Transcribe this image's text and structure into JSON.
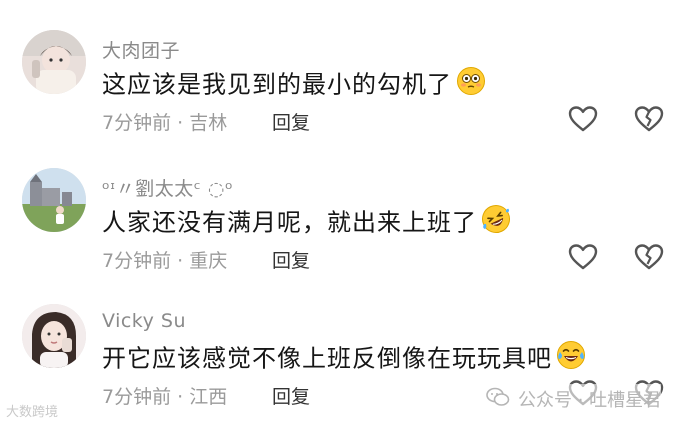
{
  "colors": {
    "username": "#8a8a8a",
    "content": "#161616",
    "meta": "#9a9a9a",
    "reply": "#333333",
    "icon_stroke": "#555555"
  },
  "comments": [
    {
      "username": "大肉团子",
      "content": "这应该是我见到的最小的勾机了",
      "emoji": "flushed-face-emoji",
      "meta": "7分钟前 · 吉林",
      "reply_label": "回复"
    },
    {
      "username": "ᵒᶦ〃劉太太ᶜ ◌ᵒ",
      "content": "人家还没有满月呢，就出来上班了",
      "emoji": "rolling-laughing-face-emoji",
      "meta": "7分钟前 · 重庆",
      "reply_label": "回复"
    },
    {
      "username": "Vicky Su",
      "content": "开它应该感觉不像上班反倒像在玩玩具吧",
      "emoji": "tears-of-joy-face-emoji",
      "meta": "7分钟前 · 江西",
      "reply_label": "回复"
    }
  ],
  "watermark": {
    "left_text": "大数跨境",
    "right_prefix": "公众号 · 吐槽星君"
  }
}
